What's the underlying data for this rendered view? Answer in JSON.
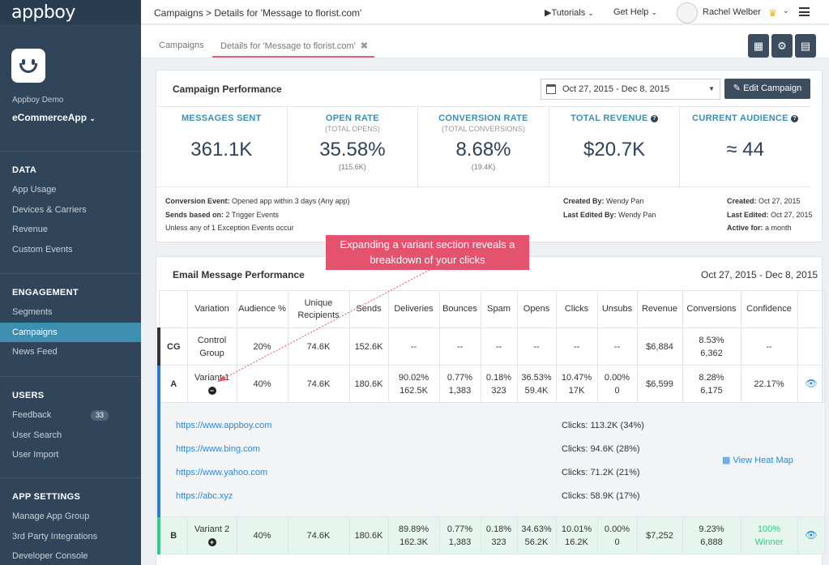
{
  "sidebar": {
    "logo": "appboy",
    "org": "Appboy Demo",
    "app": "eCommerceApp",
    "sections": [
      {
        "title": "DATA",
        "items": [
          {
            "label": "App Usage"
          },
          {
            "label": "Devices & Carriers"
          },
          {
            "label": "Revenue"
          },
          {
            "label": "Custom Events"
          }
        ]
      },
      {
        "title": "ENGAGEMENT",
        "items": [
          {
            "label": "Segments"
          },
          {
            "label": "Campaigns"
          },
          {
            "label": "News Feed"
          }
        ]
      },
      {
        "title": "USERS",
        "items": [
          {
            "label": "Feedback",
            "badge": "33"
          },
          {
            "label": "User Search"
          },
          {
            "label": "User Import"
          }
        ]
      },
      {
        "title": "APP SETTINGS",
        "items": [
          {
            "label": "Manage App Group"
          },
          {
            "label": "3rd Party Integrations"
          },
          {
            "label": "Developer Console"
          }
        ]
      }
    ]
  },
  "topbar": {
    "breadcrumb": "Campaigns > Details for 'Message to florist.com'",
    "tutorials": "Tutorials",
    "get_help": "Get Help",
    "user": "Rachel Welber"
  },
  "tabs": {
    "campaigns": "Campaigns",
    "details": "Details for 'Message to florist.com'"
  },
  "performance": {
    "title": "Campaign Performance",
    "date_range": "Oct 27, 2015 - Dec 8, 2015",
    "edit_label": "Edit Campaign",
    "stats": [
      {
        "label": "MESSAGES SENT",
        "sub": "",
        "value": "361.1K",
        "foot": ""
      },
      {
        "label": "OPEN RATE",
        "sub": "(TOTAL OPENS)",
        "value": "35.58%",
        "foot": "(115.6K)"
      },
      {
        "label": "CONVERSION RATE",
        "sub": "(TOTAL CONVERSIONS)",
        "value": "8.68%",
        "foot": "(19.4K)"
      },
      {
        "label": "TOTAL REVENUE",
        "sub": "",
        "value": "$20.7K",
        "foot": ""
      },
      {
        "label": "CURRENT AUDIENCE",
        "sub": "",
        "value": "≈ 44",
        "foot": ""
      }
    ],
    "meta_left": {
      "conv_label": "Conversion Event:",
      "conv_value": " Opened app within 3 days (Any app)",
      "sends_label": "Sends based on:",
      "sends_value": " 2 Trigger Events",
      "exception": "Unless any of 1 Exception Events occur"
    },
    "meta_mid": {
      "created_by_label": "Created By:",
      "created_by": " Wendy Pan",
      "edited_by_label": "Last Edited By:",
      "edited_by": " Wendy Pan"
    },
    "meta_right": {
      "created_label": "Created:",
      "created": " Oct 27, 2015",
      "edited_label": "Last Edited:",
      "edited": " Oct 27, 2015",
      "active_label": "Active for:",
      "active": " a month"
    }
  },
  "email": {
    "title": "Email Message Performance",
    "date_range": "Oct 27, 2015 - Dec 8, 2015",
    "columns": [
      "",
      "Variation",
      "Audience %",
      "Unique Recipients",
      "Sends",
      "Deliveries",
      "Bounces",
      "Spam",
      "Opens",
      "Clicks",
      "Unsubs",
      "Revenue",
      "Conversions",
      "Confidence",
      ""
    ],
    "rows": {
      "cg": {
        "mark": "CG",
        "name": "Control Group",
        "audience": "20%",
        "unique": "74.6K",
        "sends": "152.6K",
        "deliveries": "--",
        "bounces": "--",
        "spam": "--",
        "opens": "--",
        "clicks": "--",
        "unsubs": "--",
        "revenue": "$6,884",
        "conv1": "8.53%",
        "conv2": "6,362",
        "confidence": "--"
      },
      "a": {
        "mark": "A",
        "name": "Variant 1",
        "audience": "40%",
        "unique": "74.6K",
        "sends": "180.6K",
        "del1": "90.02%",
        "del2": "162.5K",
        "bou1": "0.77%",
        "bou2": "1,383",
        "spam1": "0.18%",
        "spam2": "323",
        "op1": "36.53%",
        "op2": "59.4K",
        "cl1": "10.47%",
        "cl2": "17K",
        "un1": "0.00%",
        "un2": "0",
        "revenue": "$6,599",
        "conv1": "8.28%",
        "conv2": "6,175",
        "confidence": "22.17%"
      },
      "b": {
        "mark": "B",
        "name": "Variant 2",
        "audience": "40%",
        "unique": "74.6K",
        "sends": "180.6K",
        "del1": "89.89%",
        "del2": "162.3K",
        "bou1": "0.77%",
        "bou2": "1,383",
        "spam1": "0.18%",
        "spam2": "323",
        "op1": "34.63%",
        "op2": "56.2K",
        "cl1": "10.01%",
        "cl2": "16.2K",
        "un1": "0.00%",
        "un2": "0",
        "revenue": "$7,252",
        "conv1": "9.23%",
        "conv2": "6,888",
        "conf1": "100%",
        "conf2": "Winner"
      }
    },
    "links": [
      {
        "url": "https://www.appboy.com",
        "clicks": "Clicks: 113.2K (34%)"
      },
      {
        "url": "https://www.bing.com",
        "clicks": "Clicks: 94.6K (28%)"
      },
      {
        "url": "https://www.yahoo.com",
        "clicks": "Clicks: 71.2K (21%)"
      },
      {
        "url": "https://abc.xyz",
        "clicks": "Clicks: 58.9K (17%)"
      }
    ],
    "heatmap": "View Heat Map"
  },
  "callout": {
    "line1": "Expanding a variant section reveals a",
    "line2": "breakdown of your clicks"
  },
  "colors": {
    "accent": "#3d8fb0",
    "sidebar": "#304559",
    "callout": "#e3536e",
    "winner": "#2fcc8b",
    "variant_a": "#2a7bd6"
  }
}
